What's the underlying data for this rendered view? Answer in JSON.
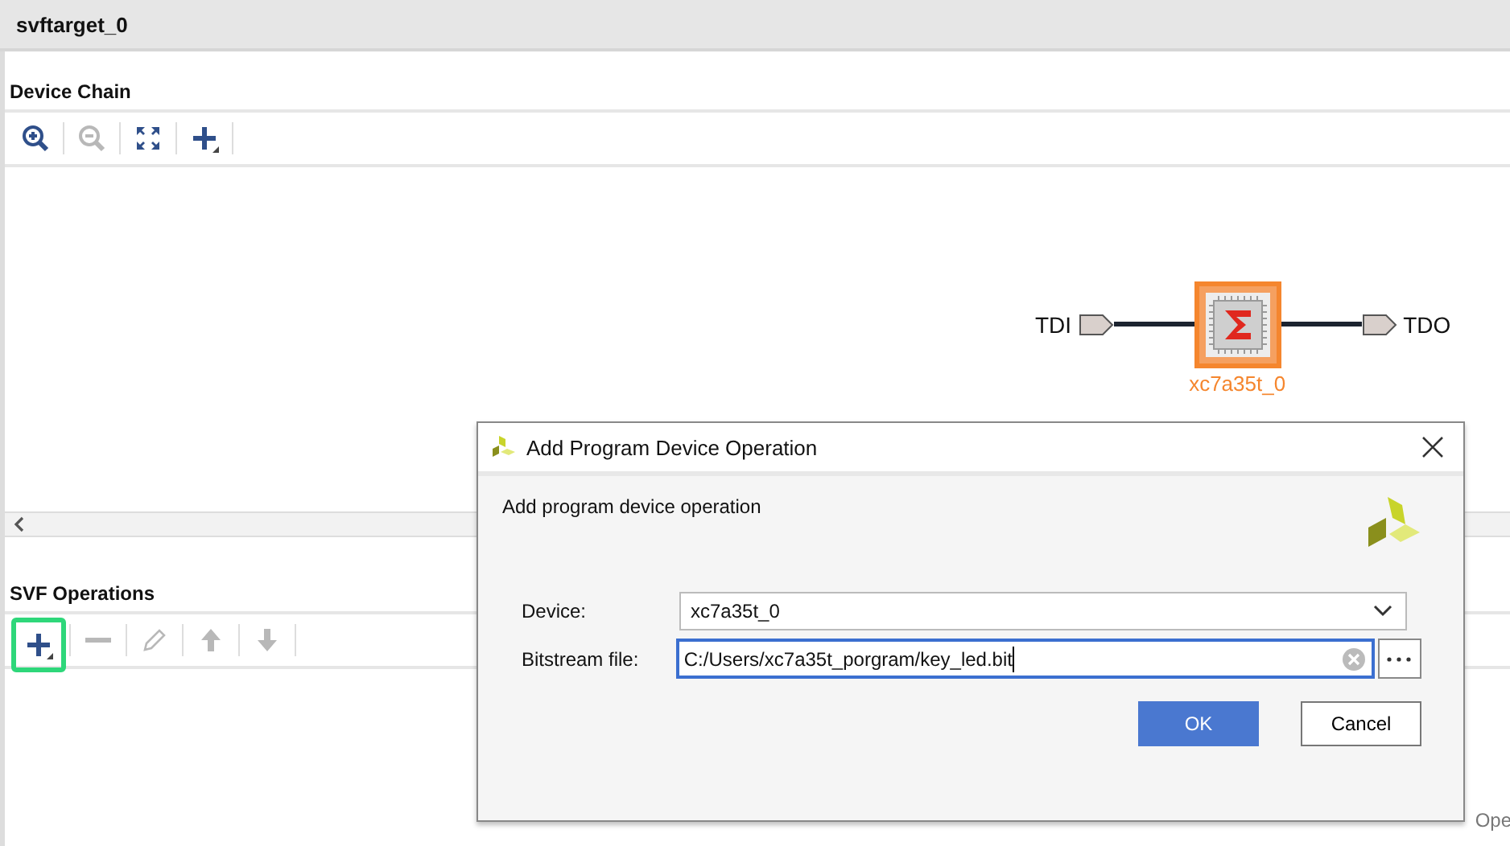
{
  "panel": {
    "title": "svftarget_0"
  },
  "device_chain": {
    "title": "Device Chain",
    "toolbar": [
      {
        "kind": "zoom-in",
        "disabled": false
      },
      {
        "kind": "zoom-out",
        "disabled": true
      },
      {
        "kind": "fit",
        "disabled": false
      },
      {
        "kind": "add",
        "disabled": false,
        "highlighted": false
      }
    ]
  },
  "diagram": {
    "input": "TDI",
    "output": "TDO",
    "device": "xc7a35t_0",
    "selected": true
  },
  "svf_operations": {
    "title": "SVF Operations",
    "toolbar": [
      {
        "kind": "add",
        "disabled": false,
        "highlighted": true
      },
      {
        "kind": "remove",
        "disabled": true
      },
      {
        "kind": "edit",
        "disabled": true
      },
      {
        "kind": "up",
        "disabled": true
      },
      {
        "kind": "down",
        "disabled": true
      }
    ]
  },
  "background_text": "Ope",
  "dialog": {
    "title": "Add Program Device Operation",
    "heading": "Add program device operation",
    "device": {
      "label": "Device:",
      "value": "xc7a35t_0"
    },
    "bitstream": {
      "label": "Bitstream file:",
      "value": "C:/Users/xc7a35t_porgram/key_led.bit",
      "focused": true
    },
    "buttons": [
      {
        "label": "OK",
        "kind": "primary"
      },
      {
        "label": "Cancel",
        "kind": "secondary"
      }
    ]
  }
}
